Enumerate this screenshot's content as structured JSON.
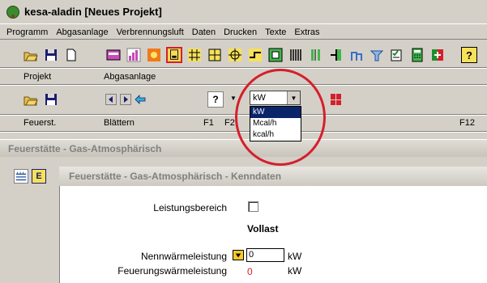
{
  "window": {
    "title": "kesa-aladin [Neues Projekt]"
  },
  "menu": [
    "Programm",
    "Abgasanlage",
    "Verbrennungsluft",
    "Daten",
    "Drucken",
    "Texte",
    "Extras"
  ],
  "toolbar_groups": {
    "row1_left": "Projekt",
    "row1_right": "Abgasanlage",
    "row2_left": "Feuerst.",
    "row2_mid": "Blättern",
    "row2_f1": "F1",
    "row2_f2": "F2",
    "row2_f12": "F12"
  },
  "unit_select": {
    "value": "kW",
    "options": [
      "kW",
      "Mcal/h",
      "kcal/h"
    ],
    "highlighted_index": 0
  },
  "help_button": "?",
  "panels": {
    "outer_title": "Feuerstätte - Gas-Atmosphärisch",
    "inner_title": "Feuerstätte - Gas-Atmosphärisch - Kenndaten",
    "left_icon_letter": "E"
  },
  "form": {
    "leistungsbereich_label": "Leistungsbereich",
    "leistungsbereich_checked": false,
    "vollast_label": "Vollast",
    "nennwaerme_label": "Nennwärmeleistung",
    "nennwaerme_value": "0",
    "nennwaerme_unit": "kW",
    "feuerung_label": "Feuerungswärmeleistung",
    "feuerung_value": "0",
    "feuerung_unit": "kW"
  },
  "colors": {
    "highlight": "#0a246a",
    "annotation": "#d4202c",
    "value_red": "#d4202c"
  }
}
